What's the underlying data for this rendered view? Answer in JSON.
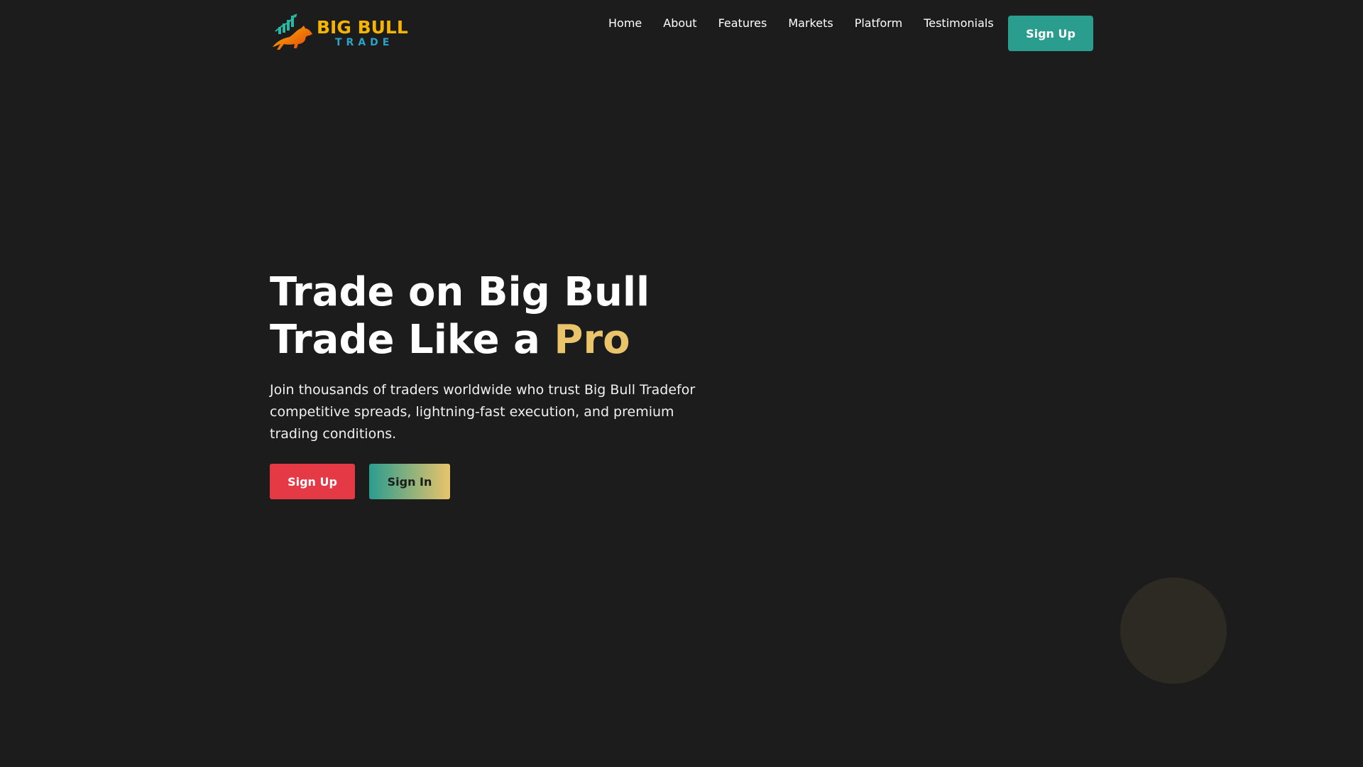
{
  "brand": {
    "logo_main": "BIG BULL",
    "logo_sub": "TRADE"
  },
  "nav": {
    "items": [
      {
        "label": "Home"
      },
      {
        "label": "About"
      },
      {
        "label": "Features"
      },
      {
        "label": "Markets"
      },
      {
        "label": "Platform"
      },
      {
        "label": "Testimonials"
      }
    ],
    "signup_label": "Sign Up"
  },
  "hero": {
    "title_line1": "Trade on Big Bull",
    "title_line2_prefix": "Trade Like a ",
    "title_line2_accent": "Pro",
    "description": "Join thousands of traders worldwide who trust Big Bull Tradefor competitive spreads, lightning-fast execution, and premium trading conditions.",
    "signup_label": "Sign Up",
    "signin_label": "Sign In"
  },
  "colors": {
    "background": "#1c1c1c",
    "primary_teal": "#2a9d8f",
    "accent_gold": "#e9c46a",
    "cta_red": "#e63946"
  }
}
